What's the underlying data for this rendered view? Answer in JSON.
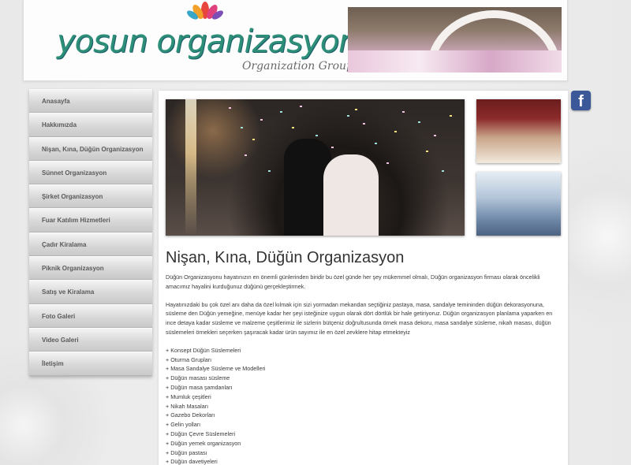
{
  "header": {
    "logo_text": "yosun organizasyon",
    "logo_subtitle": "Organization Group"
  },
  "social": {
    "facebook_label": "f"
  },
  "sidebar": {
    "items": [
      {
        "label": "Anasayfa"
      },
      {
        "label": "Hakkımızda"
      },
      {
        "label": "Nişan, Kına, Düğün Organizasyon"
      },
      {
        "label": "Sünnet Organizasyon"
      },
      {
        "label": "Şirket Organizasyon"
      },
      {
        "label": "Fuar Katılım Hizmetleri"
      },
      {
        "label": "Çadır Kiralama"
      },
      {
        "label": "Piknik Organizasyon"
      },
      {
        "label": "Satış ve Kiralama"
      },
      {
        "label": "Foto Galeri"
      },
      {
        "label": "Video Galeri"
      },
      {
        "label": "İletişim"
      }
    ]
  },
  "main": {
    "title": "Nişan, Kına, Düğün Organizasyon",
    "paragraphs": [
      "Düğün Organizasyonu hayatınızın en önemli günlerinden biridir bu özel günde her şey mükemmel olmalı, Düğün organizasyon firması olarak öncelikli amacımız hayalini kurduğunuz düğünü gerçekleştirmek.",
      "Hayatınızdaki bu çok özel anı daha da özel kılmak için sizi yormadan mekandan seçtiğiniz pastaya, masa, sandalye temininden düğün dekorasyonuna, süsleme den Düğün yemeğine, menüye kadar her şeyi isteğinize uygun olarak dört dörtlük bir hale getiriyoruz. Düğün organizasyon planlama yaparken en ince detaya kadar süsleme ve malzeme çeşitlerimiz ile sizlerin bütçeniz doğrultusunda örnek masa dekoru, masa sandalye süsleme, nikah masası, düğün süslemeleri örnekleri seçerken şaşıracak kadar ürün sayımız ile en özel zevklere hitap etmekteyiz"
    ],
    "list": [
      "+ Konsept Düğün Süslemeleri",
      "+ Oturma Grupları",
      "+ Masa Sandalye Süsleme ve Modelleri",
      "+ Düğün masası süsleme",
      "+ Düğün masa şamdanları",
      "+ Mumluk çeşitleri",
      "+ Nikah Masaları",
      "+ Gazebo Dekorları",
      "+ Gelin yolları",
      "+ Düğün Çevre Süslemeleri",
      "+ Düğün yemek organizasyon",
      "+ Düğün pastası",
      "+ Düğün davetiyeleri"
    ]
  },
  "colors": {
    "logo_green": "#2d8f78",
    "facebook_blue": "#3b5998",
    "nav_text": "#5a5a5a"
  }
}
